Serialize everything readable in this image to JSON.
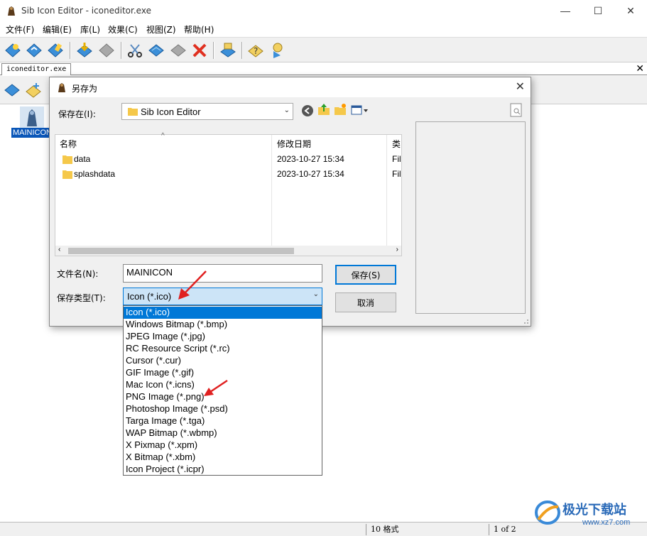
{
  "window": {
    "title": "Sib Icon Editor - iconeditor.exe",
    "minimize": "—",
    "maximize": "☐",
    "close": "✕"
  },
  "menu": [
    "文件(F)",
    "编辑(E)",
    "库(L)",
    "效果(C)",
    "视图(Z)",
    "帮助(H)"
  ],
  "document_tab": {
    "label": "iconeditor.exe",
    "close": "✕"
  },
  "workarea": {
    "icon_label": "MAINICON"
  },
  "status": {
    "formats": "10 格式",
    "page": "1 of 2"
  },
  "dialog": {
    "title": "另存为",
    "close": "✕",
    "save_in_label": "保存在(I):",
    "save_in_value": "Sib Icon Editor",
    "columns": {
      "name": "名称",
      "date": "修改日期",
      "type": "类"
    },
    "files": [
      {
        "name": "data",
        "date": "2023-10-27 15:34",
        "type": "Fil"
      },
      {
        "name": "splashdata",
        "date": "2023-10-27 15:34",
        "type": "Fil"
      }
    ],
    "filename_label": "文件名(N):",
    "filename_value": "MAINICON",
    "filetype_label": "保存类型(T):",
    "filetype_value": "Icon (*.ico)",
    "save_button": "保存(S)",
    "cancel_button": "取消"
  },
  "type_options": [
    "Icon (*.ico)",
    "Windows Bitmap (*.bmp)",
    "JPEG Image (*.jpg)",
    "RC Resource Script (*.rc)",
    "Cursor (*.cur)",
    "GIF Image (*.gif)",
    "Mac Icon (*.icns)",
    "PNG Image (*.png)",
    "Photoshop Image (*.psd)",
    "Targa Image (*.tga)",
    "WAP Bitmap (*.wbmp)",
    "X Pixmap (*.xpm)",
    "X Bitmap (*.xbm)",
    "Icon Project (*.icpr)"
  ],
  "watermark": {
    "text": "极光下载站",
    "url": "www.xz7.com"
  },
  "colors": {
    "accent": "#0078d7",
    "selection": "#0a56b8",
    "arrow": "#e02020"
  }
}
